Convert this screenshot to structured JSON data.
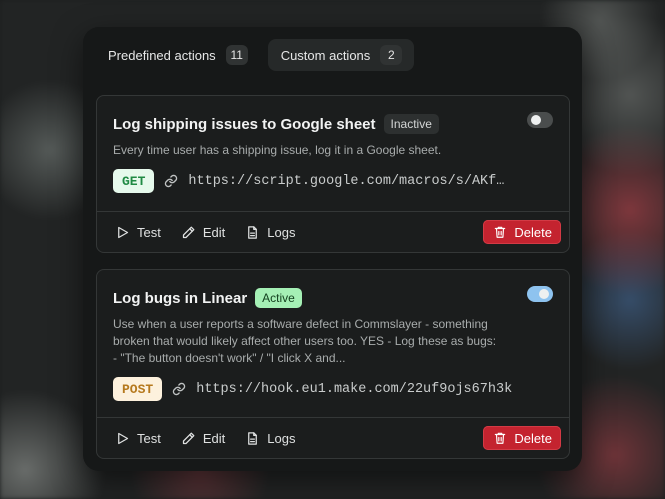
{
  "tabs": [
    {
      "label": "Predefined actions",
      "count": "11",
      "active": false
    },
    {
      "label": "Custom actions",
      "count": "2",
      "active": true
    }
  ],
  "actions": [
    {
      "title": "Log shipping issues to Google sheet",
      "status": "Inactive",
      "enabled": false,
      "description": "Every time user has a shipping issue, log it in a Google sheet.",
      "method": "GET",
      "url": "https://script.google.com/macros/s/AKfycbx",
      "buttons": {
        "test": "Test",
        "edit": "Edit",
        "logs": "Logs",
        "delete": "Delete"
      }
    },
    {
      "title": "Log bugs in Linear",
      "status": "Active",
      "enabled": true,
      "description": "Use when a user reports a software defect in Commslayer - something broken that would likely affect other users too. YES - Log these as bugs: - \"The button doesn't work\" / \"I click X and...",
      "method": "POST",
      "url": "https://hook.eu1.make.com/22uf9ojs67h3k",
      "buttons": {
        "test": "Test",
        "edit": "Edit",
        "logs": "Logs",
        "delete": "Delete"
      }
    }
  ]
}
